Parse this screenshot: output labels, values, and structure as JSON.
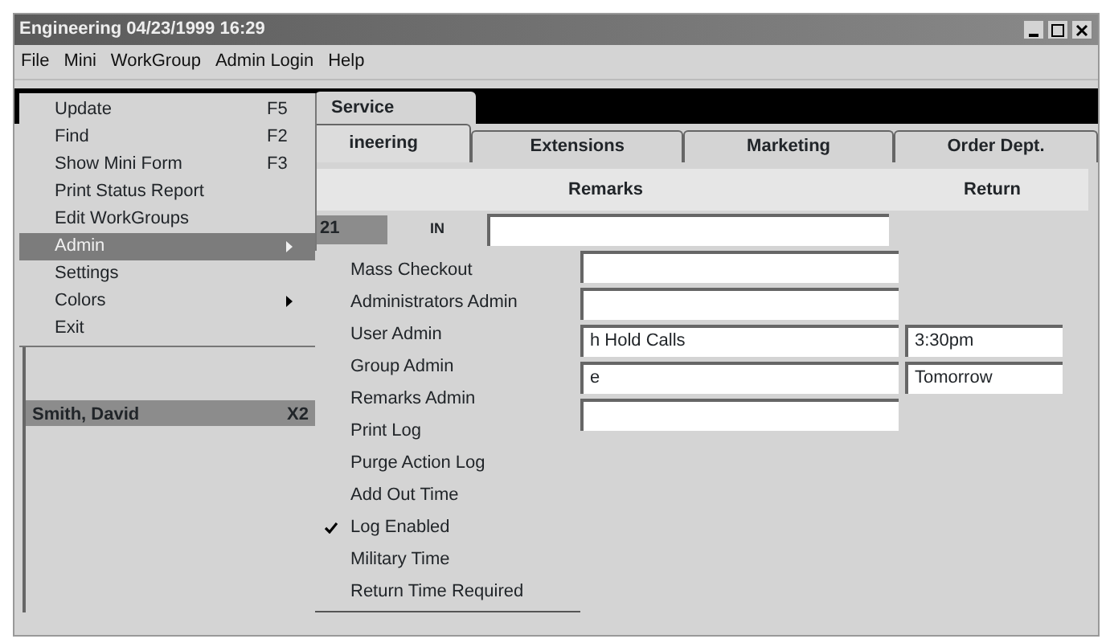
{
  "window": {
    "title": "Engineering  04/23/1999   16:29"
  },
  "menu_bar": [
    {
      "label": "File"
    },
    {
      "label": "Mini"
    },
    {
      "label": "WorkGroup"
    },
    {
      "label": "Admin Login"
    },
    {
      "label": "Help"
    }
  ],
  "file_menu": [
    {
      "label": "Update",
      "shortcut": "F5",
      "kind": "command",
      "selected": false
    },
    {
      "label": "Find",
      "shortcut": "F2",
      "kind": "command",
      "selected": false
    },
    {
      "label": "Show Mini Form",
      "shortcut": "F3",
      "kind": "command",
      "selected": false
    },
    {
      "label": "Print Status Report",
      "kind": "command",
      "selected": false
    },
    {
      "label": "Edit WorkGroups",
      "kind": "command",
      "selected": false
    },
    {
      "label": "Admin",
      "kind": "submenu",
      "selected": true
    },
    {
      "label": "Settings",
      "kind": "command",
      "selected": false
    },
    {
      "label": "Colors",
      "kind": "submenu",
      "selected": false
    },
    {
      "label": "Exit",
      "kind": "command",
      "selected": false
    }
  ],
  "admin_submenu": [
    {
      "label": "Mass Checkout",
      "checked": false
    },
    {
      "label": "Administrators Admin",
      "checked": false
    },
    {
      "label": "User Admin",
      "checked": false
    },
    {
      "label": "Group Admin",
      "checked": false
    },
    {
      "label": "Remarks Admin",
      "checked": false
    },
    {
      "label": "Print Log",
      "checked": false
    },
    {
      "label": "Purge Action Log",
      "checked": false
    },
    {
      "label": "Add Out Time",
      "checked": false
    },
    {
      "label": "Log Enabled",
      "checked": true
    },
    {
      "label": "Military Time",
      "checked": false
    },
    {
      "label": "Return Time Required",
      "checked": false
    }
  ],
  "upper_tabs": [
    {
      "label": "Service"
    }
  ],
  "tabs": [
    {
      "label": "ineering",
      "selected": true
    },
    {
      "label": "Extensions",
      "selected": false
    },
    {
      "label": "Marketing",
      "selected": false
    },
    {
      "label": "Order Dept.",
      "selected": false
    }
  ],
  "columns": [
    "Remarks",
    "Return"
  ],
  "rows": [
    {
      "number": "21",
      "status": "IN",
      "remarks": ""
    },
    {
      "remarks": ""
    },
    {
      "remarks": ""
    },
    {
      "remarks": "h   Hold Calls",
      "return": "3:30pm"
    },
    {
      "remarks": "e",
      "return": "Tomorrow"
    },
    {
      "remarks": ""
    }
  ],
  "staff_list": [
    {
      "name": "Smith, David",
      "extension": "X2"
    }
  ]
}
